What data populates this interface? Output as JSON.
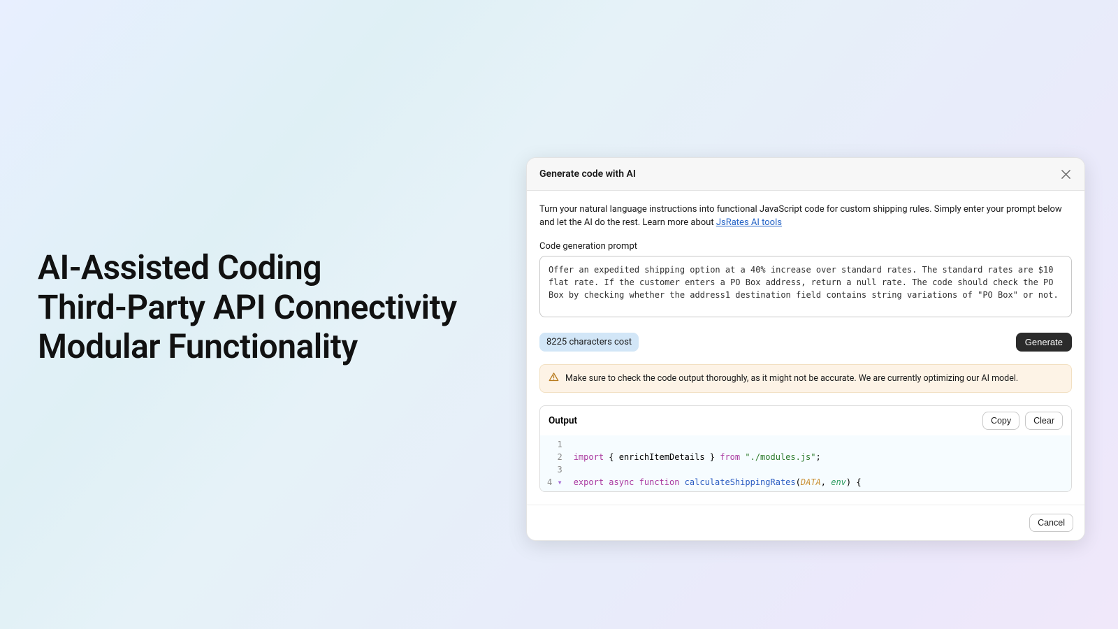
{
  "hero": {
    "line1": "AI-Assisted Coding",
    "line2": "Third-Party API Connectivity",
    "line3": "Modular Functionality"
  },
  "modal": {
    "title": "Generate code with AI",
    "desc_pre": "Turn your natural language instructions into functional JavaScript code for custom shipping rules. Simply enter your prompt below and let the AI do the rest. Learn more about ",
    "desc_link": "JsRates AI tools",
    "prompt_label": "Code generation prompt",
    "prompt_value": "Offer an expedited shipping option at a 40% increase over standard rates. The standard rates are $10 flat rate. If the customer enters a PO Box address, return a null rate. The code should check the PO Box by checking whether the address1 destination field contains string variations of \"PO Box\" or not.",
    "cost_badge": "8225 characters cost",
    "generate_label": "Generate",
    "alert_text": "Make sure to check the code output thoroughly, as it might not be accurate. We are currently optimizing our AI model.",
    "output_title": "Output",
    "copy_label": "Copy",
    "clear_label": "Clear",
    "cancel_label": "Cancel",
    "code": {
      "ln": [
        "1",
        "2",
        "3",
        "4"
      ],
      "l2_import": "import",
      "l2_braces": " { enrichItemDetails } ",
      "l2_from": "from",
      "l2_str": " \"./modules.js\"",
      "l2_semi": ";",
      "l4_export": "export",
      "l4_async": " async",
      "l4_function": " function",
      "l4_name": " calculateShippingRates",
      "l4_open": "(",
      "l4_data": "DATA",
      "l4_comma": ", ",
      "l4_env": "env",
      "l4_close": ") {",
      "l4_caret": "▾"
    }
  }
}
